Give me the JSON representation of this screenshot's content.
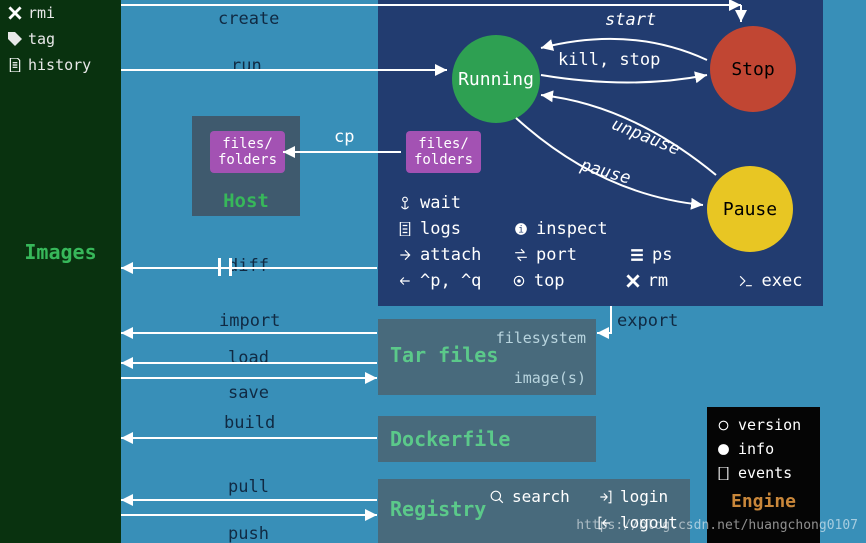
{
  "sidebar": {
    "items": [
      {
        "label": "rmi"
      },
      {
        "label": "tag"
      },
      {
        "label": "history"
      }
    ],
    "title": "Images"
  },
  "edges": {
    "create": "create",
    "run": "run",
    "cp": "cp",
    "start": "start",
    "kill_stop": "kill, stop",
    "unpause": "unpause",
    "pause": "pause",
    "diff": "diff",
    "import": "import",
    "load": "load",
    "save": "save",
    "build": "build",
    "pull": "pull",
    "push": "push",
    "export": "export"
  },
  "nodes": {
    "running": "Running",
    "stop": "Stop",
    "pause": "Pause",
    "host_title": "Host",
    "files_folders": "files/\nfolders",
    "tar_title": "Tar files",
    "tar_sub1": "filesystem",
    "tar_sub2": "image(s)",
    "dockerfile_title": "Dockerfile",
    "registry_title": "Registry",
    "engine_title": "Engine"
  },
  "container_cmds": {
    "wait": "wait",
    "logs": "logs",
    "inspect": "inspect",
    "attach": "attach",
    "port": "port",
    "ps": "ps",
    "detach": "^p, ^q",
    "top": "top",
    "rm": "rm",
    "exec": "exec"
  },
  "registry_cmds": {
    "search": "search",
    "login": "login",
    "logout": "logout"
  },
  "engine_cmds": {
    "version": "version",
    "info": "info",
    "events": "events"
  },
  "watermark": "https://blog.csdn.net/huangchong0107"
}
